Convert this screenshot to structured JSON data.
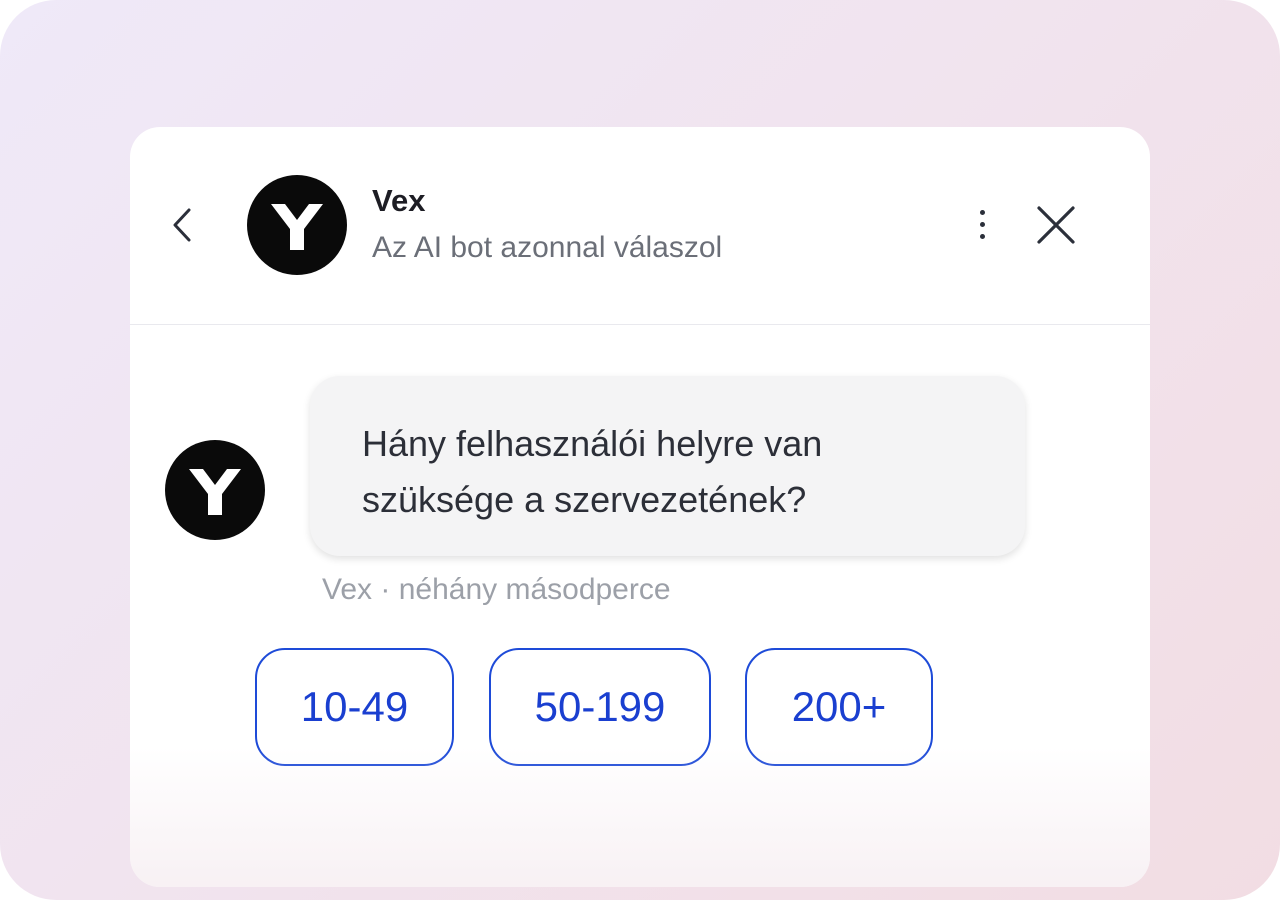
{
  "header": {
    "back_icon": "chevron-left-icon",
    "bot_name": "Vex",
    "bot_status": "Az AI bot azonnal válaszol",
    "menu_icon": "more-vertical-icon",
    "close_icon": "close-icon"
  },
  "avatar": {
    "icon": "vex-logo-icon",
    "color": "#0a0a0a"
  },
  "message": {
    "text": "Hány felhasználói helyre van szüksége a szervezetének?",
    "meta": "Vex · néhány másodperce"
  },
  "quick_replies": [
    {
      "label": "10-49"
    },
    {
      "label": "50-199"
    },
    {
      "label": "200+"
    }
  ],
  "colors": {
    "accent": "#1a3fd0",
    "bubble": "#f4f4f5",
    "background_gradient": [
      "#efe9f8",
      "#f2dde3"
    ]
  }
}
